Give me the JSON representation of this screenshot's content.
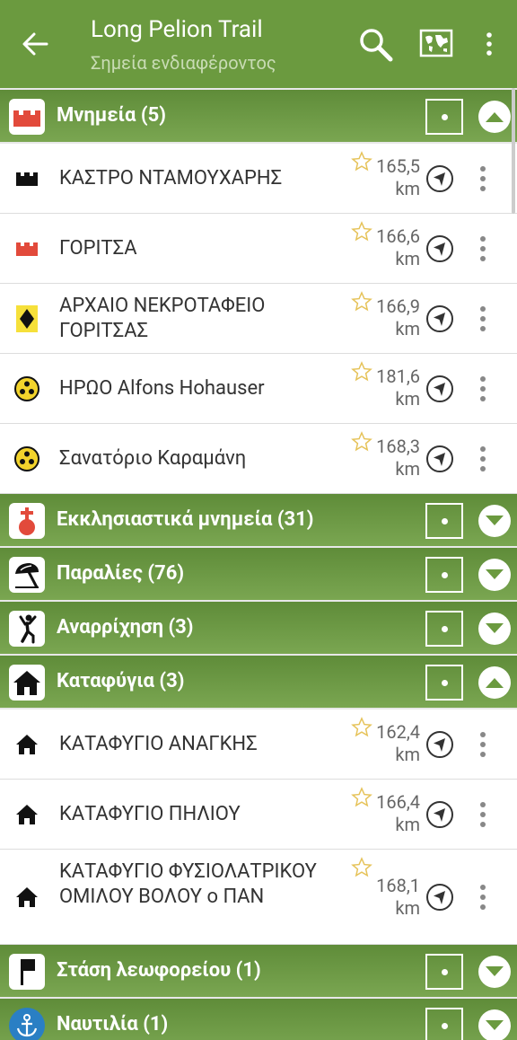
{
  "appbar": {
    "title": "Long Pelion Trail",
    "subtitle": "Σημεία ενδιαφέροντος",
    "back_icon": "arrow-back-icon",
    "search_icon": "search-icon",
    "map_icon": "world-map-icon",
    "more_icon": "more-vert-icon"
  },
  "categories": [
    {
      "label": "Μνημεία (5)",
      "icon": "castle-icon",
      "expanded": true,
      "items": [
        {
          "name": "ΚΑΣΤΡΟ ΝΤΑΜΟΥΧΑΡΗΣ",
          "dist_value": "165,5",
          "dist_unit": "km",
          "icon": "castle-icon"
        },
        {
          "name": "ΓΟΡΙΤΣΑ",
          "dist_value": "166,6",
          "dist_unit": "km",
          "icon": "castle-icon"
        },
        {
          "name": "ΑΡΧΑΙΟ ΝΕΚΡΟΤΑΦΕΙΟ ΓΟΡΙΤΣΑΣ",
          "dist_value": "166,9",
          "dist_unit": "km",
          "icon": "diamond-sign-icon"
        },
        {
          "name": "ΗΡΩΟ Alfons Hohauser",
          "dist_value": "181,6",
          "dist_unit": "km",
          "icon": "three-dot-icon"
        },
        {
          "name": "Σανατόριο Καραμάνη",
          "dist_value": "168,3",
          "dist_unit": "km",
          "icon": "three-dot-icon"
        }
      ]
    },
    {
      "label": "Εκκλησιαστικά μνημεία (31)",
      "icon": "church-icon",
      "expanded": false
    },
    {
      "label": "Παραλίες (76)",
      "icon": "beach-umbrella-icon",
      "expanded": false
    },
    {
      "label": "Αναρρίχηση (3)",
      "icon": "climbing-icon",
      "expanded": false
    },
    {
      "label": "Καταφύγια (3)",
      "icon": "shelter-icon",
      "expanded": true,
      "items": [
        {
          "name": "ΚΑΤΑΦΥΓΙΟ ΑΝΑΓΚΗΣ",
          "dist_value": "162,4",
          "dist_unit": "km",
          "icon": "shelter-icon"
        },
        {
          "name": "ΚΑΤΑΦΥΓΙΟ ΠΗΛΙΟΥ",
          "dist_value": "166,4",
          "dist_unit": "km",
          "icon": "shelter-icon"
        },
        {
          "name": "ΚΑΤΑΦΥΓΙΟ ΦΥΣΙΟΛΑΤΡΙΚΟΥ ΟΜΙΛΟΥ ΒΟΛΟΥ ο ΠΑΝ",
          "dist_value": "168,1",
          "dist_unit": "km",
          "icon": "shelter-icon"
        }
      ]
    },
    {
      "label": "Στάση λεωφορείου (1)",
      "icon": "bus-stop-flag-icon",
      "expanded": false
    },
    {
      "label": "Ναυτιλία (1)",
      "icon": "anchor-icon",
      "expanded": false
    }
  ],
  "colors": {
    "appbar": "#6b9a3f",
    "category_bar": "#6b9a3f",
    "star": "#e6c35a"
  }
}
